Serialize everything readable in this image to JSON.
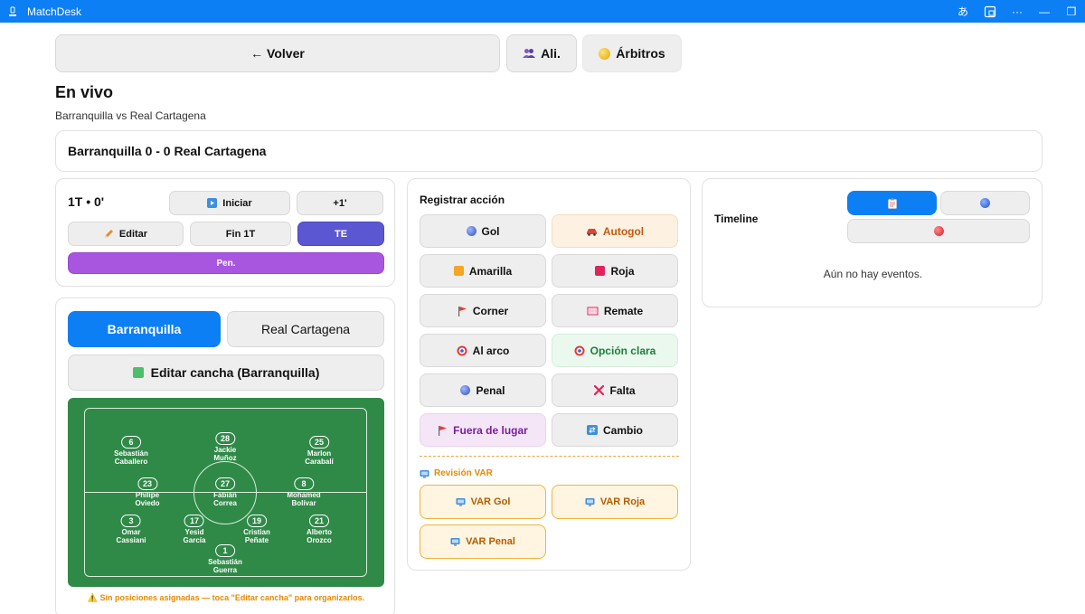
{
  "window": {
    "title": "MatchDesk",
    "tb_translate": "あ",
    "tb_cast": "▭",
    "tb_more": "···",
    "tb_min": "—",
    "tb_restore": "❐"
  },
  "nav": {
    "back_label": "← Volver",
    "lineups_label": "Ali.",
    "referees_label": "Árbitros"
  },
  "page": {
    "title": "En vivo",
    "subtitle": "Barranquilla vs Real Cartagena"
  },
  "score": {
    "text": "Barranquilla 0 - 0 Real Cartagena"
  },
  "clock": {
    "label": "1T • 0'",
    "start_label": "Iniciar",
    "plus_label": "+1'",
    "edit_label": "Editar",
    "end_half_label": "Fin 1T",
    "te_label": "TE",
    "pen_label": "Pen."
  },
  "teams": {
    "home": "Barranquilla",
    "away": "Real Cartagena",
    "edit_field_label": "Editar cancha (Barranquilla)",
    "players": [
      {
        "number": "6",
        "name": "Sebastián\nCaballero"
      },
      {
        "number": "28",
        "name": "Jackie\nMuñoz"
      },
      {
        "number": "25",
        "name": "Marlon\nCarabalí"
      },
      {
        "number": "23",
        "name": "Philipe\nOviedo"
      },
      {
        "number": "27",
        "name": "Fabián\nCorrea"
      },
      {
        "number": "8",
        "name": "Mohamed\nBolívar"
      },
      {
        "number": "3",
        "name": "Omar\nCassiani"
      },
      {
        "number": "17",
        "name": "Yesid\nGarcía"
      },
      {
        "number": "19",
        "name": "Cristian\nPeñate"
      },
      {
        "number": "21",
        "name": "Alberto\nOrozco"
      },
      {
        "number": "1",
        "name": "Sebastián\nGuerra"
      }
    ],
    "warning": "⚠️ Sin posiciones asignadas — toca \"Editar cancha\" para organizarlos."
  },
  "actions": {
    "title": "Registrar acción",
    "buttons": [
      {
        "label": "Gol",
        "icon": "soccer-ball-icon"
      },
      {
        "label": "Autogol",
        "icon": "car-icon"
      },
      {
        "label": "Amarilla",
        "icon": "yellow-card-icon"
      },
      {
        "label": "Roja",
        "icon": "red-card-icon"
      },
      {
        "label": "Corner",
        "icon": "flag-icon"
      },
      {
        "label": "Remate",
        "icon": "goal-net-icon"
      },
      {
        "label": "Al arco",
        "icon": "target-icon"
      },
      {
        "label": "Opción clara",
        "icon": "target-icon"
      },
      {
        "label": "Penal",
        "icon": "soccer-ball-icon"
      },
      {
        "label": "Falta",
        "icon": "cross-icon"
      },
      {
        "label": "Fuera de lugar",
        "icon": "flag-icon"
      },
      {
        "label": "Cambio",
        "icon": "swap-icon"
      }
    ],
    "var_title": "Revisión VAR",
    "var_buttons": [
      {
        "label": "VAR Gol"
      },
      {
        "label": "VAR Roja"
      },
      {
        "label": "VAR Penal"
      }
    ]
  },
  "timeline": {
    "title": "Timeline",
    "empty_text": "Aún no hay eventos."
  },
  "colors": {
    "accent": "#0d7ff5",
    "te": "#5b57d3",
    "pen": "#a855e0",
    "var": "#f0b43c",
    "pitch": "#2f8a47"
  }
}
